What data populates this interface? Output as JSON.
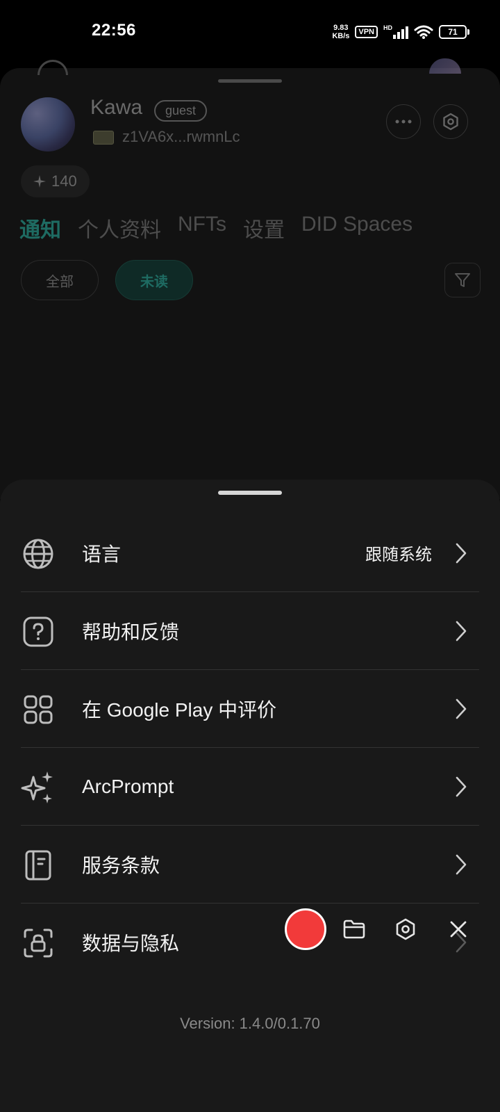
{
  "status_bar": {
    "time": "22:56",
    "net_speed_value": "9.83",
    "net_speed_unit": "KB/s",
    "vpn": "VPN",
    "network_type": "HD",
    "battery": "71"
  },
  "profile": {
    "name": "Kawa",
    "badge": "guest",
    "did": "z1VA6x...rwmnLc",
    "points": "140",
    "tabs": [
      "通知",
      "个人资料",
      "NFTs",
      "设置",
      "DID Spaces"
    ],
    "filters": {
      "all": "全部",
      "unread": "未读"
    }
  },
  "settings_menu": {
    "items": [
      {
        "label": "语言",
        "value": "跟随系统",
        "icon": "globe-icon"
      },
      {
        "label": "帮助和反馈",
        "icon": "help-icon"
      },
      {
        "label": "在 Google Play 中评价",
        "icon": "apps-grid-icon"
      },
      {
        "label": "ArcPrompt",
        "icon": "sparkle-icon"
      },
      {
        "label": "服务条款",
        "icon": "book-icon"
      },
      {
        "label": "数据与隐私",
        "icon": "lock-scan-icon"
      }
    ],
    "version": "Version: 1.4.0/0.1.70"
  },
  "colors": {
    "accent": "#1e6b62",
    "sheet_bg": "#191919",
    "record_red": "#f23a3a"
  }
}
